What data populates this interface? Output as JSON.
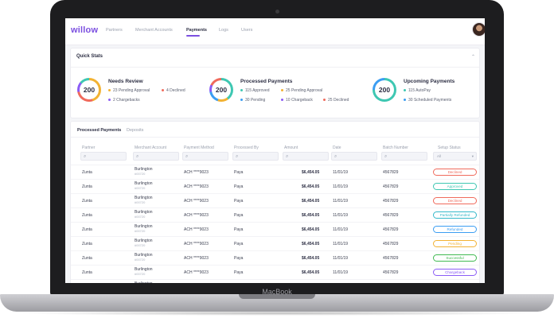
{
  "device": {
    "brand": "MacBook"
  },
  "nav": {
    "logo": "willow",
    "items": [
      {
        "label": "Partners",
        "active": false
      },
      {
        "label": "Merchant Accounts",
        "active": false
      },
      {
        "label": "Payments",
        "active": true
      },
      {
        "label": "Logs",
        "active": false
      },
      {
        "label": "Users",
        "active": false
      }
    ]
  },
  "quick_stats": {
    "title": "Quick Stats",
    "chevron": "⌃",
    "cards": [
      {
        "title": "Needs Review",
        "value": "200",
        "lines": [
          {
            "text": "23 Pending Approval",
            "color": "#f2b233"
          },
          {
            "text": "4 Declined",
            "color": "#f06a5c"
          },
          {
            "text": "2 Chargebacks",
            "color": "#8b5cf6"
          }
        ]
      },
      {
        "title": "Processed Payments",
        "value": "200",
        "lines": [
          {
            "text": "115 Approved",
            "color": "#3ec7b2"
          },
          {
            "text": "25 Pending Approval",
            "color": "#f2b233"
          },
          {
            "text": "30 Pending",
            "color": "#3b9df2"
          },
          {
            "text": "10 Chargeback",
            "color": "#8b5cf6"
          },
          {
            "text": "25 Declined",
            "color": "#f06a5c"
          }
        ]
      },
      {
        "title": "Upcoming Payments",
        "value": "200",
        "lines": [
          {
            "text": "115 AutoPay",
            "color": "#3ec7b2"
          },
          {
            "text": "30 Scheduled Payments",
            "color": "#3b9df2"
          }
        ]
      }
    ]
  },
  "tabs": [
    {
      "label": "Processed Payments",
      "active": true
    },
    {
      "label": "Deposits",
      "active": false
    }
  ],
  "table": {
    "columns": [
      "Partner",
      "Merchant Account",
      "Payment Method",
      "Processed By",
      "Amount",
      "Date",
      "Batch Number",
      "Setup Status"
    ],
    "status_filter_placeholder": "All",
    "rows": [
      {
        "partner": "Zunta",
        "merchant": "Burlington",
        "merchant_id": "#00720",
        "method": "ACH ****9023",
        "processed_by": "Paya",
        "amount": "$6,454.05",
        "date": "11/01/19",
        "batch": "4567829",
        "status": "Declined",
        "status_color": "#f06a5c"
      },
      {
        "partner": "Zunta",
        "merchant": "Burlington",
        "merchant_id": "#00720",
        "method": "ACH ****9023",
        "processed_by": "Paya",
        "amount": "$6,454.05",
        "date": "11/01/19",
        "batch": "4567829",
        "status": "Approved",
        "status_color": "#3ec7b2"
      },
      {
        "partner": "Zunta",
        "merchant": "Burlington",
        "merchant_id": "#00720",
        "method": "ACH ****9023",
        "processed_by": "Paya",
        "amount": "$6,454.05",
        "date": "11/01/19",
        "batch": "4567829",
        "status": "Declined",
        "status_color": "#f06a5c"
      },
      {
        "partner": "Zunta",
        "merchant": "Burlington",
        "merchant_id": "#00720",
        "method": "ACH ****9023",
        "processed_by": "Paya",
        "amount": "$6,454.05",
        "date": "11/01/19",
        "batch": "4567829",
        "status": "Partially Refunded",
        "status_color": "#34b8c9"
      },
      {
        "partner": "Zunta",
        "merchant": "Burlington",
        "merchant_id": "#00720",
        "method": "ACH ****9023",
        "processed_by": "Paya",
        "amount": "$6,454.05",
        "date": "11/01/19",
        "batch": "4567829",
        "status": "Refunded",
        "status_color": "#3b9df2"
      },
      {
        "partner": "Zunta",
        "merchant": "Burlington",
        "merchant_id": "#00720",
        "method": "ACH ****9023",
        "processed_by": "Paya",
        "amount": "$6,454.05",
        "date": "11/01/19",
        "batch": "4567829",
        "status": "Pending",
        "status_color": "#f2b233"
      },
      {
        "partner": "Zunta",
        "merchant": "Burlington",
        "merchant_id": "#00720",
        "method": "ACH ****9023",
        "processed_by": "Paya",
        "amount": "$6,454.05",
        "date": "11/01/19",
        "batch": "4567829",
        "status": "Successful",
        "status_color": "#3fb950"
      },
      {
        "partner": "Zunta",
        "merchant": "Burlington",
        "merchant_id": "#00720",
        "method": "ACH ****9023",
        "processed_by": "Paya",
        "amount": "$6,454.05",
        "date": "11/01/19",
        "batch": "4567829",
        "status": "Chargeback",
        "status_color": "#8b5cf6"
      },
      {
        "partner": "",
        "merchant": "Burlington",
        "merchant_id": "",
        "method": "",
        "processed_by": "",
        "amount": "",
        "date": "",
        "batch": "",
        "status": "",
        "status_color": "#3fb950"
      }
    ]
  }
}
